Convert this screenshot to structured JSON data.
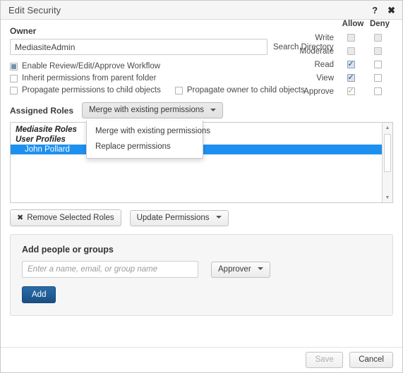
{
  "window": {
    "title": "Edit Security",
    "help_icon": "question-mark-icon",
    "close_icon": "close-x-icon"
  },
  "owner": {
    "label": "Owner",
    "value": "MediasiteAdmin",
    "placeholder": "",
    "search_link": "Search Directory"
  },
  "options": [
    {
      "label": "Enable Review/Edit/Approve Workflow",
      "state": "square-filled"
    },
    {
      "label": "Inherit permissions from parent folder",
      "state": "unchecked"
    },
    {
      "label": "Propagate permissions to child objects",
      "state": "unchecked"
    },
    {
      "label": "Propagate owner to child objects",
      "state": "unchecked"
    }
  ],
  "assigned_roles": {
    "label": "Assigned Roles",
    "merge_button": "Merge with existing permissions",
    "menu_open": true,
    "menu_items": [
      "Merge with existing permissions",
      "Replace permissions"
    ],
    "list": [
      {
        "text": "Mediasite Roles",
        "type": "group",
        "selected": false
      },
      {
        "text": "User Profiles",
        "type": "group",
        "selected": false
      },
      {
        "text": "John Pollard",
        "type": "item",
        "selected": true
      }
    ],
    "scroll_up_icon": "triangle-up-icon",
    "scroll_down_icon": "triangle-down-icon"
  },
  "permissions": {
    "columns": [
      "Allow",
      "Deny"
    ],
    "rows": [
      {
        "label": "Write",
        "allow": "disabled-unchecked",
        "deny": "unchecked"
      },
      {
        "label": "Moderate",
        "allow": "disabled-unchecked",
        "deny": "unchecked"
      },
      {
        "label": "Read",
        "allow": "checked",
        "deny": "unchecked"
      },
      {
        "label": "View",
        "allow": "checked",
        "deny": "unchecked"
      },
      {
        "label": "Approve",
        "allow": "disabled-checked",
        "deny": "unchecked"
      }
    ]
  },
  "actions": {
    "remove_roles": "Remove Selected Roles",
    "remove_icon": "x-mark-icon",
    "update_permissions": "Update Permissions"
  },
  "add_panel": {
    "heading": "Add people or groups",
    "input_value": "",
    "input_placeholder": "Enter a name, email, or group name",
    "role_select": "Approver",
    "add_button": "Add"
  },
  "footer": {
    "save": "Save",
    "save_disabled": true,
    "cancel": "Cancel"
  },
  "colors": {
    "selection_blue": "#1e90f0",
    "primary_button": "#1a4f85",
    "checkbox_fill": "#6f93a8",
    "titlebar_bg": "#f5f5f5"
  }
}
